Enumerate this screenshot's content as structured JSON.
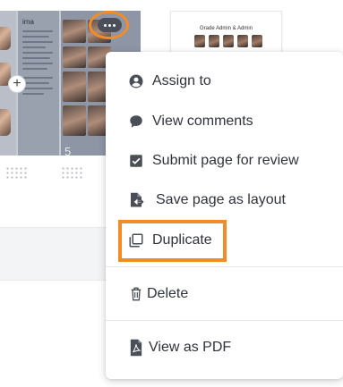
{
  "spread": {
    "text_title": "ima",
    "page_number": "5"
  },
  "thumbnail_2": {
    "title": "Grade Admin & Admin"
  },
  "menu": {
    "items": [
      {
        "label": "Assign to",
        "icon": "account-circle-icon"
      },
      {
        "label": "View comments",
        "icon": "comment-bubble-icon"
      },
      {
        "label": "Submit page for review",
        "icon": "checkbox-icon"
      },
      {
        "label": "Save page as layout",
        "icon": "file-export-icon"
      },
      {
        "label": "Duplicate",
        "icon": "copy-icon"
      },
      {
        "label": "Delete",
        "icon": "trash-icon"
      },
      {
        "label": "View as PDF",
        "icon": "pdf-file-icon"
      }
    ]
  },
  "colors": {
    "highlight": "#f28c28",
    "text": "#2f333a",
    "icon": "#4a4f57"
  }
}
